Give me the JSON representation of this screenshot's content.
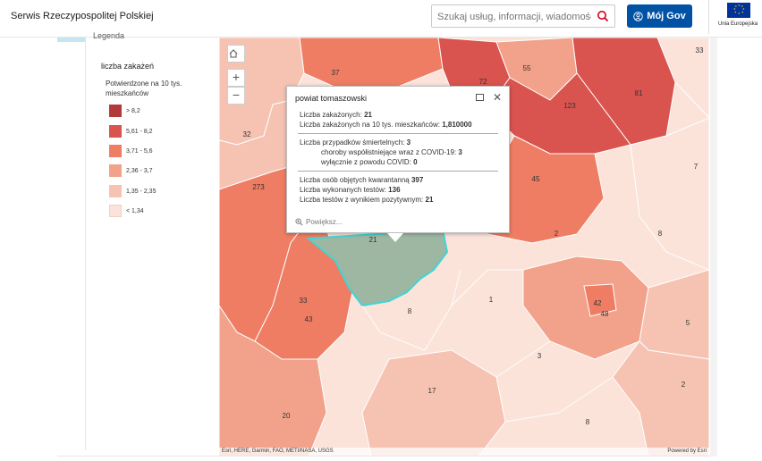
{
  "header": {
    "site_title": "Serwis Rzeczypospolitej Polskiej",
    "search_placeholder": "Szukaj usług, informacji, wiadomości",
    "login_label": "Mój Gov",
    "eu_label": "Unia Europejska",
    "icons": [
      "search-icon",
      "user-icon",
      "eu-flag-icon"
    ]
  },
  "legend": {
    "top_label": "Legenda",
    "title": "liczba zakażeń",
    "subtitle": "Potwierdzone na 10 tys. mieszkańców",
    "classes": [
      {
        "label": "> 8,2",
        "color": "#b23a3a"
      },
      {
        "label": "5,61 - 8,2",
        "color": "#d9534f"
      },
      {
        "label": "3,71 - 5,6",
        "color": "#ee7d63"
      },
      {
        "label": "2,36 - 3,7",
        "color": "#f2a28a"
      },
      {
        "label": "1,35 - 2,35",
        "color": "#f6c3b2"
      },
      {
        "label": "< 1,34",
        "color": "#fbe3da"
      }
    ]
  },
  "map": {
    "controls": [
      "home-icon",
      "zoom-in-icon",
      "zoom-out-icon"
    ],
    "labels": [
      "37",
      "72",
      "55",
      "81",
      "123",
      "33",
      "32",
      "273",
      "45",
      "7",
      "21",
      "2",
      "8",
      "1",
      "33",
      "43",
      "8",
      "42",
      "48",
      "5",
      "3",
      "17",
      "2",
      "20",
      "8"
    ],
    "attribution_left": "Esri, HERE, Garmin, FAO, METI/NASA, USGS",
    "attribution_right": "Powered by Esri",
    "selected_region": "Tomaszowski"
  },
  "popup": {
    "title": "powiat tomaszowski",
    "infected_label": "Liczba zakażonych:",
    "infected_value": "21",
    "per10k_label": "Liczba zakażonych na 10 tys. mieszkańców:",
    "per10k_value": "1,810000",
    "deaths_label": "Liczba przypadków śmiertelnych:",
    "deaths_value": "3",
    "comorbid_label": "choroby współistniejące wraz z COVID-19:",
    "comorbid_value": "3",
    "covid_only_label": "wyłącznie z powodu COVID:",
    "covid_only_value": "0",
    "quarantine_label": "Liczba osób objętych kwarantanną",
    "quarantine_value": "397",
    "tests_label": "Liczba wykonanych testów:",
    "tests_value": "136",
    "positive_label": "Liczba testów z wynikiem pozytywnym:",
    "positive_value": "21",
    "zoom_label": "Powiększ..."
  }
}
